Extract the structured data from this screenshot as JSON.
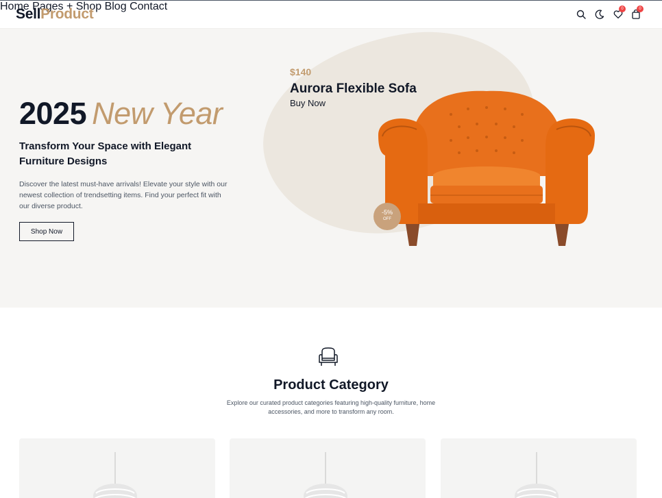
{
  "header": {
    "logo_part1": "Sell",
    "logo_part2": "Product",
    "nav": [
      {
        "label": "Home"
      },
      {
        "label": "Pages +"
      },
      {
        "label": "Shop"
      },
      {
        "label": "Blog"
      },
      {
        "label": "Contact"
      }
    ],
    "wishlist_count": "0",
    "cart_count": "0",
    "icons": [
      "search-icon",
      "moon-icon",
      "heart-icon",
      "cart-icon"
    ]
  },
  "hero": {
    "title_year": "2025",
    "title_accent": "New Year",
    "subtitle": "Transform Your Space with Elegant Furniture Designs",
    "description": "Discover the latest must-have arrivals! Elevate your style with our newest collection of trendsetting items. Find your perfect fit with our diverse product.",
    "cta_label": "Shop Now",
    "product_price": "$140",
    "product_name": "Aurora Flexible Sofa",
    "product_cta": "Buy Now",
    "discount_value": "-5%",
    "discount_label": "OFF"
  },
  "category": {
    "title": "Product Category",
    "description": "Explore our curated product categories featuring high-quality furniture, home accessories, and more to transform any room.",
    "icon": "armchair-icon"
  },
  "colors": {
    "accent": "#c29b6e",
    "badge": "#ef4444",
    "chair": "#e56a12",
    "hero_bg": "#f6f5f3"
  }
}
